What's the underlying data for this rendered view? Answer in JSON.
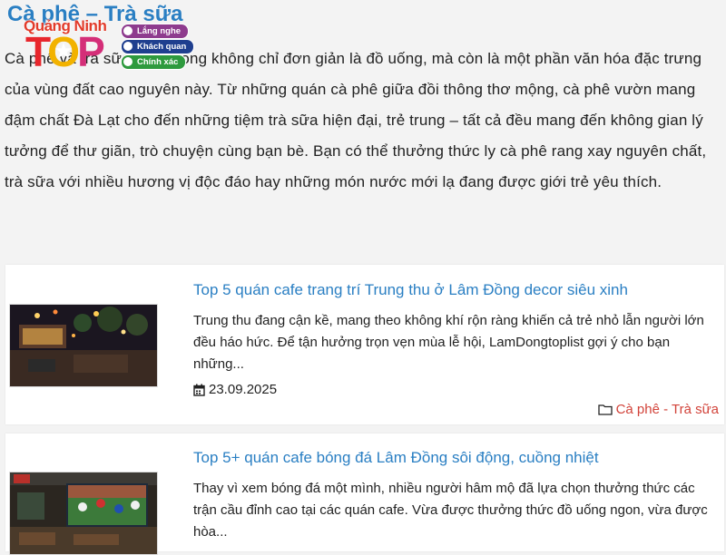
{
  "category": {
    "title": "Cà phê – Trà sữa",
    "intro": "Cà phê và trà sữa Lâm Đồng không chỉ đơn giản là đồ uống, mà còn là một phần văn hóa đặc trưng của vùng đất cao nguyên này. Từ những quán cà phê giữa đồi thông thơ mộng, cà phê vườn mang đậm chất Đà Lạt cho đến những tiệm trà sữa hiện đại, trẻ trung – tất cả đều mang đến không gian lý tưởng để thư giãn, trò chuyện cùng bạn bè. Bạn có thể thưởng thức ly cà phê rang xay nguyên chất, trà sữa với nhiều hương vị độc đáo hay những món nước mới lạ đang được giới trẻ yêu thích."
  },
  "logo": {
    "brand": "Quảng Ninh",
    "top": "TOP",
    "tags": [
      "Lắng nghe",
      "Khách quan",
      "Chính xác"
    ]
  },
  "posts": [
    {
      "title": "Top 5 quán cafe trang trí Trung thu ở Lâm Đồng decor siêu xinh",
      "excerpt": "Trung thu đang cận kề, mang theo không khí rộn ràng khiến cả trẻ nhỏ lẫn người lớn đều háo hức. Để tận hưởng trọn vẹn mùa lễ hội, LamDongtoplist gợi ý cho bạn những...",
      "date": "23.09.2025",
      "category": "Cà phê - Trà sữa"
    },
    {
      "title": "Top 5+ quán cafe bóng đá Lâm Đồng sôi động, cuồng nhiệt",
      "excerpt": "Thay vì xem bóng đá một mình, nhiều người hâm mộ đã lựa chọn thưởng thức các trận cầu đỉnh cao tại các quán cafe. Vừa được thưởng thức đồ uống ngon, vừa được hòa..."
    }
  ],
  "icons": {
    "date": "calendar-icon",
    "category": "folder-icon"
  },
  "colors": {
    "link": "#2a7fc3",
    "category": "#d2433a",
    "background": "#f3f3f3"
  }
}
